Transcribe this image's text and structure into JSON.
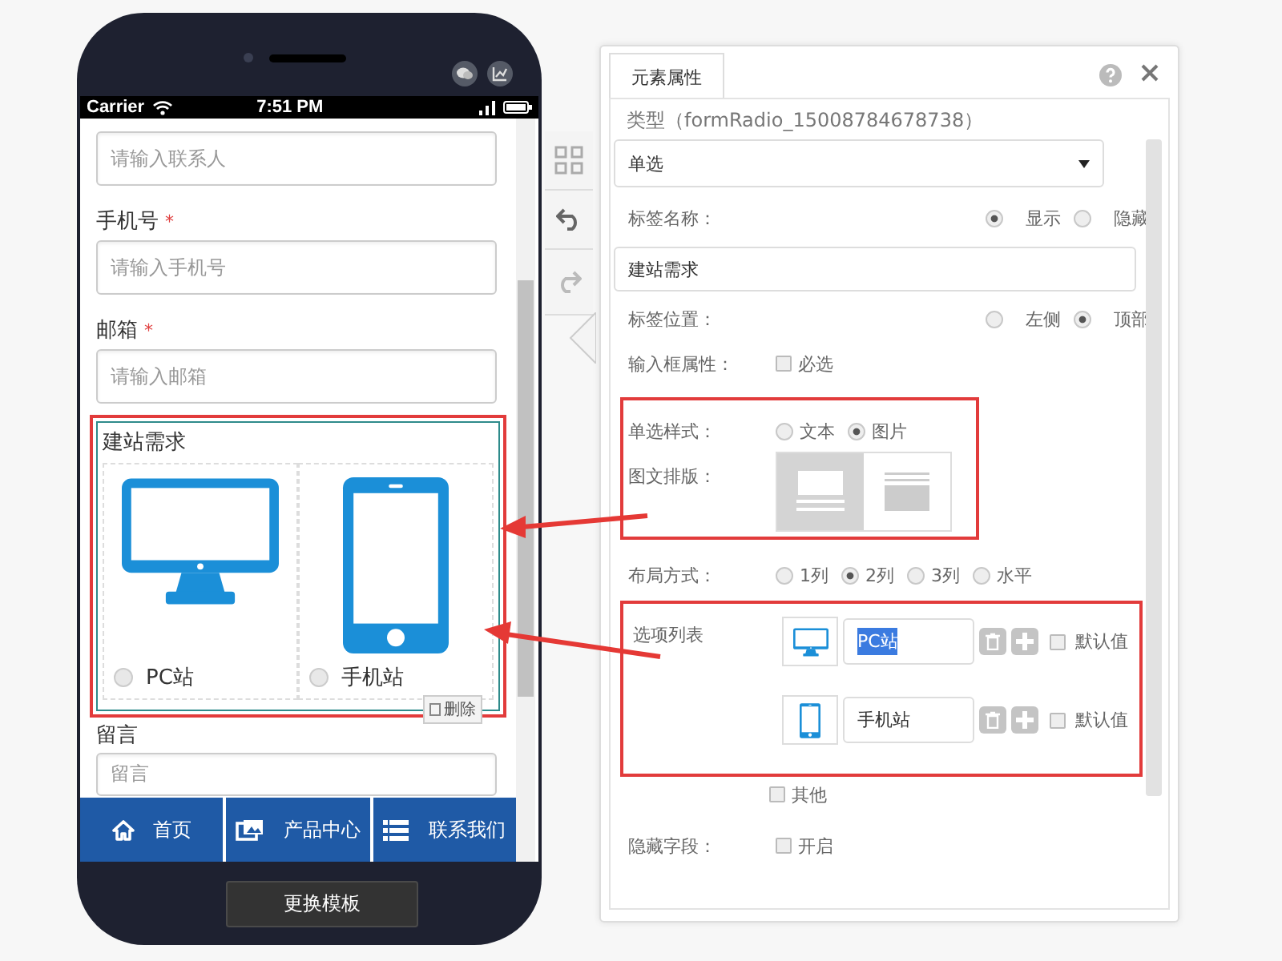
{
  "phone": {
    "status_bar": {
      "carrier": "Carrier",
      "time": "7:51 PM"
    },
    "fields": [
      {
        "placeholder": "请输入联系人"
      },
      {
        "label": "手机号",
        "mark": "*",
        "placeholder": "请输入手机号"
      },
      {
        "label": "邮箱",
        "mark": "*",
        "placeholder": "请输入邮箱"
      }
    ],
    "radio_group": {
      "label": "建站需求",
      "options": [
        {
          "label": "PC站",
          "kind": "monitor",
          "selected": false
        },
        {
          "label": "手机站",
          "kind": "tablet",
          "selected": false
        }
      ],
      "delete_button": "删除"
    },
    "message": {
      "label": "留言",
      "placeholder": "留言"
    },
    "nav": [
      {
        "label": "首页",
        "kind": "home"
      },
      {
        "label": "产品中心",
        "kind": "gallery"
      },
      {
        "label": "联系我们",
        "kind": "list"
      }
    ],
    "change_template_button": "更换模板"
  },
  "panel": {
    "tab": "元素属性",
    "type_line": "类型（formRadio_15008784678738）",
    "type_select": "单选",
    "label_name": {
      "label": "标签名称：",
      "options": [
        {
          "label": "显示",
          "selected": true
        },
        {
          "label": "隐藏",
          "selected": false
        }
      ],
      "value": "建站需求"
    },
    "label_position": {
      "label": "标签位置：",
      "options": [
        {
          "label": "左侧",
          "selected": false
        },
        {
          "label": "顶部",
          "selected": true
        }
      ]
    },
    "input_attr": {
      "label": "输入框属性：",
      "checkbox": {
        "label": "必选",
        "checked": false
      }
    },
    "radio_style": {
      "label": "单选样式：",
      "options": [
        {
          "label": "文本",
          "selected": false
        },
        {
          "label": "图片",
          "selected": true
        }
      ]
    },
    "image_layout": {
      "label": "图文排版：",
      "options": [
        {
          "kind": "image-top",
          "selected": true
        },
        {
          "kind": "image-bottom",
          "selected": false
        }
      ]
    },
    "columns": {
      "label": "布局方式：",
      "options": [
        {
          "label": "1列",
          "selected": false
        },
        {
          "label": "2列",
          "selected": true
        },
        {
          "label": "3列",
          "selected": false
        },
        {
          "label": "水平",
          "selected": false
        }
      ]
    },
    "option_list": {
      "label": "选项列表",
      "items": [
        {
          "kind": "monitor",
          "value": "PC站",
          "text_selected": true,
          "default_label": "默认值",
          "default_checked": false
        },
        {
          "kind": "tablet",
          "value": "手机站",
          "text_selected": false,
          "default_label": "默认值",
          "default_checked": false
        }
      ]
    },
    "other": {
      "label": "其他",
      "checked": false
    },
    "hidden_field": {
      "label": "隐藏字段：",
      "checkbox": {
        "label": "开启",
        "checked": false
      }
    }
  }
}
